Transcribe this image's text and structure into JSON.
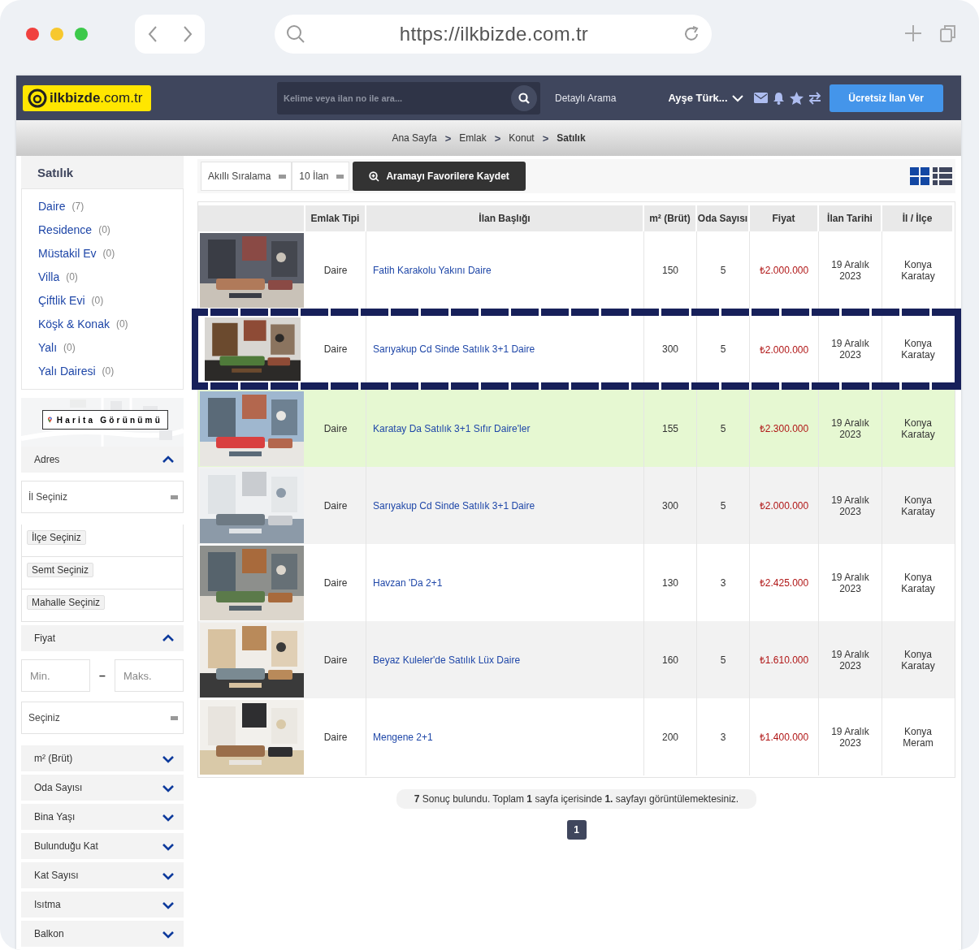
{
  "browser": {
    "url": "https://ilkbizde.com.tr"
  },
  "header": {
    "logo": "**ilkbizde**.com.tr",
    "search": {
      "placeholder": "Kelime veya ilan no ile ara..."
    },
    "detailed_search": "Detaylı Arama",
    "user": "Ayşe Türk...",
    "post_button": "Ücretsiz İlan Ver"
  },
  "breadcrumb": [
    {
      "kind": "link",
      "label": "Ana Sayfa"
    },
    {
      "kind": "separator",
      "label": ">"
    },
    {
      "kind": "link",
      "label": "Emlak"
    },
    {
      "kind": "separator",
      "label": ">"
    },
    {
      "kind": "link",
      "label": "Konut"
    },
    {
      "kind": "separator",
      "label": ">"
    },
    {
      "kind": "current",
      "label": "Satılık"
    }
  ],
  "sidebar": {
    "title": "Satılık",
    "categories": [
      {
        "label": "Daire",
        "count": "(7)"
      },
      {
        "label": "Residence",
        "count": "(0)"
      },
      {
        "label": "Müstakil Ev",
        "count": "(0)"
      },
      {
        "label": "Villa",
        "count": "(0)"
      },
      {
        "label": "Çiftlik Evi",
        "count": "(0)"
      },
      {
        "label": "Köşk & Konak",
        "count": "(0)"
      },
      {
        "label": "Yalı",
        "count": "(0)"
      },
      {
        "label": "Yalı Dairesi",
        "count": "(0)"
      }
    ],
    "map_button": "Harita Görünümü",
    "filters": [
      {
        "kind": "section",
        "label": "Adres",
        "expanded": true
      },
      {
        "kind": "select",
        "label": "İl Seçiniz"
      },
      {
        "kind": "chip",
        "label": "İlçe Seçiniz"
      },
      {
        "kind": "chip",
        "label": "Semt Seçiniz"
      },
      {
        "kind": "chip",
        "label": "Mahalle Seçiniz"
      },
      {
        "kind": "section",
        "label": "Fiyat",
        "expanded": true
      },
      {
        "kind": "range",
        "min": {
          "placeholder": "Min."
        },
        "separator": "–",
        "max": {
          "placeholder": "Maks."
        }
      },
      {
        "kind": "select",
        "label": "Seçiniz"
      },
      {
        "kind": "section",
        "label": "m² (Brüt)",
        "expanded": false
      },
      {
        "kind": "section",
        "label": "Oda Sayısı",
        "expanded": false
      },
      {
        "kind": "section",
        "label": "Bina Yaşı",
        "expanded": false
      },
      {
        "kind": "section",
        "label": "Bulunduğu Kat",
        "expanded": false
      },
      {
        "kind": "section",
        "label": "Kat Sayısı",
        "expanded": false
      },
      {
        "kind": "section",
        "label": "Isıtma",
        "expanded": false
      },
      {
        "kind": "section",
        "label": "Balkon",
        "expanded": false
      }
    ]
  },
  "toolbar": {
    "sort": "Akıllı Sıralama",
    "per_page": "10 İlan",
    "save_button": "Aramayı Favorilere Kaydet"
  },
  "table": {
    "columns": [
      "Emlak Tipi",
      "İlan Başlığı",
      "m² (Brüt)",
      "Oda Sayısı",
      "Fiyat",
      "İlan Tarihi",
      "İl / İlçe"
    ],
    "rows": [
      {
        "kind": "normal",
        "type": "Daire",
        "title": "Fatih Karakolu Yakını Daire",
        "area": "150",
        "rooms": "5",
        "price": "₺2.000.000",
        "date": "19 Aralık 2023",
        "location": "Konya Karatay"
      },
      {
        "kind": "featured",
        "type": "Daire",
        "title": "Sarıyakup Cd Sinde Satılık 3+1 Daire",
        "area": "300",
        "rooms": "5",
        "price": "₺2.000.000",
        "date": "19 Aralık 2023",
        "location": "Konya Karatay"
      },
      {
        "kind": "highlighted",
        "type": "Daire",
        "title": "Karatay Da Satılık 3+1 Sıfır Daire'ler",
        "area": "155",
        "rooms": "5",
        "price": "₺2.300.000",
        "date": "19 Aralık 2023",
        "location": "Konya Karatay"
      },
      {
        "kind": "normal",
        "type": "Daire",
        "title": "Sarıyakup Cd Sinde Satılık 3+1 Daire",
        "area": "300",
        "rooms": "5",
        "price": "₺2.000.000",
        "date": "19 Aralık 2023",
        "location": "Konya Karatay"
      },
      {
        "kind": "normal",
        "type": "Daire",
        "title": "Havzan 'Da 2+1",
        "area": "130",
        "rooms": "3",
        "price": "₺2.425.000",
        "date": "19 Aralık 2023",
        "location": "Konya Karatay"
      },
      {
        "kind": "normal",
        "type": "Daire",
        "title": "Beyaz Kuleler'de Satılık Lüx Daire",
        "area": "160",
        "rooms": "5",
        "price": "₺1.610.000",
        "date": "19 Aralık 2023",
        "location": "Konya Karatay"
      },
      {
        "kind": "normal",
        "type": "Daire",
        "title": "Mengene 2+1",
        "area": "200",
        "rooms": "3",
        "price": "₺1.400.000",
        "date": "19 Aralık 2023",
        "location": "Konya Meram"
      }
    ]
  },
  "summary": "**7** Sonuç bulundu. Toplam **1** sayfa içerisinde **1.** sayfayı görüntülemektesiniz.",
  "pagination": [
    {
      "label": "1",
      "selected": true
    }
  ]
}
